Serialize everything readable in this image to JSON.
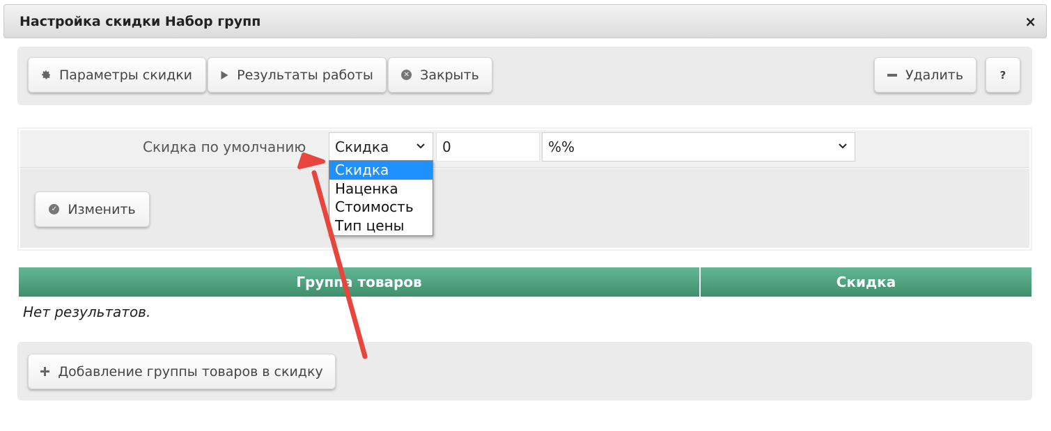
{
  "dialog": {
    "title": "Настройка скидки Набор групп",
    "close_symbol": "×"
  },
  "toolbar": {
    "params_label": "Параметры скидки",
    "results_label": "Результаты работы",
    "close_label": "Закрыть",
    "delete_label": "Удалить",
    "help_label": "?"
  },
  "form": {
    "default_discount_label": "Скидка по умолчанию",
    "type_select_value": "Скидка",
    "amount_value": "0",
    "unit_select_value": "%%",
    "type_options": [
      "Скидка",
      "Наценка",
      "Стоимость",
      "Тип цены"
    ],
    "change_label": "Изменить"
  },
  "table": {
    "columns": [
      "Группа товаров",
      "Скидка"
    ],
    "empty_text": "Нет результатов."
  },
  "footer": {
    "add_group_label": "Добавление группы товаров в скидку"
  },
  "colors": {
    "table_header": "#4fa37f",
    "dropdown_selected": "#1e90ff",
    "annotation_arrow": "#e8453c"
  },
  "icons": {
    "params": "gear-icon",
    "results": "play-icon",
    "close": "close-circle-icon",
    "delete": "minus-icon",
    "change": "check-circle-icon",
    "add": "plus-icon"
  }
}
